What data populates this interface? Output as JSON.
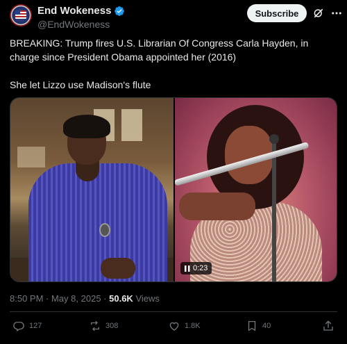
{
  "author": {
    "display_name": "End Wokeness",
    "handle": "@EndWokeness",
    "verified_color": "#1d9bf0"
  },
  "header": {
    "subscribe_label": "Subscribe"
  },
  "tweet": {
    "lines": [
      "BREAKING: Trump fires U.S. Librarian Of Congress Carla Hayden, in charge since President Obama appointed her (2016)",
      "She let Lizzo use Madison's flute"
    ]
  },
  "media": {
    "video_time": "0:23"
  },
  "meta": {
    "time": "8:50 PM",
    "date": "May 8, 2025",
    "views_count": "50.6K",
    "views_label": "Views"
  },
  "actions": {
    "replies": "127",
    "reposts": "308",
    "likes": "1.8K",
    "bookmarks": "40"
  },
  "colors": {
    "background": "#000000",
    "text": "#e7e9ea",
    "muted": "#71767b",
    "border": "#2f3336"
  }
}
